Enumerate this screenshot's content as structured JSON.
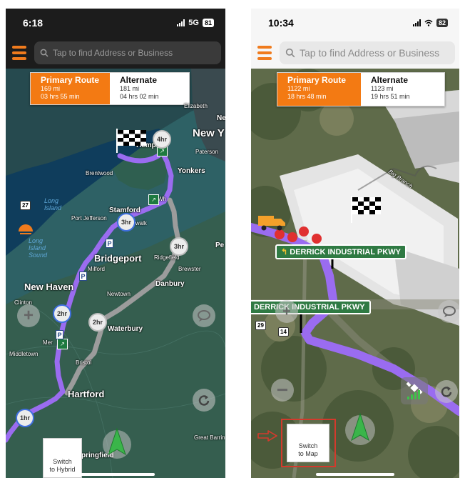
{
  "left": {
    "status": {
      "time": "6:18",
      "network": "5G",
      "battery": "81"
    },
    "search": {
      "placeholder": "Tap to find Address or Business"
    },
    "routes": {
      "primary": {
        "title": "Primary Route",
        "distance": "169 mi",
        "time": "03 hrs 55 min"
      },
      "alternate": {
        "title": "Alternate",
        "distance": "181 mi",
        "time": "04 hrs 02 min"
      }
    },
    "labels": {
      "new_york": "New Y",
      "elizabeth": "Elizabeth",
      "ne": "Ne",
      "paterson": "Paterson",
      "hempstead": "Hemp",
      "yonkers": "Yonkers",
      "brentwood": "Brentwood",
      "long_island": "Long\nIsland",
      "port_jefferson": "Port Jefferson",
      "stamford": "Stamford",
      "white_plains": "Wh",
      "norwalk": "Norwalk",
      "long_island_sound": "Long\nIsland\nSound",
      "bridgeport": "Bridgeport",
      "ridgefield": "Ridgefield",
      "milford": "Milford",
      "brewster": "Brewster",
      "pe": "Pe",
      "new_haven": "New Haven",
      "danbury": "Danbury",
      "clinton": "Clinton",
      "newtown": "Newtown",
      "waterbury": "Waterbury",
      "middletown": "Middletown",
      "bristol": "Bristol",
      "hartford": "Hartford",
      "springfield": "pringfield",
      "great_barrington": "Great Barrin",
      "mer": "Mer"
    },
    "hours": {
      "h4": "4hr",
      "h3a": "3hr",
      "h3b": "3hr",
      "h2a": "2hr",
      "h2b": "2hr",
      "h1": "1hr"
    },
    "shields": {
      "s27": "27"
    },
    "switch_label": "Switch\nto Hybrid"
  },
  "right": {
    "status": {
      "time": "10:34",
      "battery": "82"
    },
    "search": {
      "placeholder": "Tap to find Address or Business"
    },
    "routes": {
      "primary": {
        "title": "Primary Route",
        "distance": "1122 mi",
        "time": "18 hrs 48 min"
      },
      "alternate": {
        "title": "Alternate",
        "distance": "1123 mi",
        "time": "19 hrs 51 min"
      }
    },
    "labels": {
      "big_branch": "Big Branch"
    },
    "signs": {
      "sign1": "DERRICK INDUSTRIAL PKWY",
      "sign2": "DERRICK INDUSTRIAL PKWY"
    },
    "shields": {
      "s29": "29",
      "s14": "14"
    },
    "switch_label": "Switch\nto Map"
  },
  "colors": {
    "primary_route": "#f37a13",
    "route_line": "#9a6cf0",
    "alt_line": "#9c9c9c",
    "brand_orange": "#f07b1d",
    "callout_red": "#d33a2c"
  }
}
